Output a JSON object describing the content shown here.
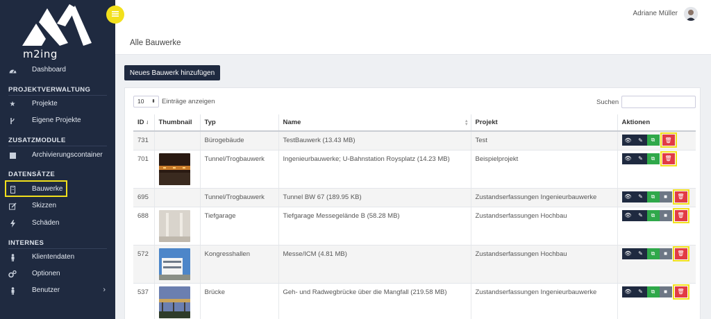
{
  "app": {
    "logo_text": "m2ing"
  },
  "user": {
    "name": "Adriane Müller"
  },
  "page": {
    "title": "Alle Bauwerke",
    "add_button": "Neues Bauwerk hinzufügen"
  },
  "sidebar": {
    "dashboard": "Dashboard",
    "sections": {
      "projekte": "PROJEKTVERWALTUNG",
      "zusatz": "ZUSATZMODULE",
      "daten": "DATENSÄTZE",
      "internes": "INTERNES"
    },
    "items": {
      "projekte": "Projekte",
      "eigene": "Eigene Projekte",
      "archiv": "Archivierungscontainer",
      "bauwerke": "Bauwerke",
      "skizzen": "Skizzen",
      "schaeden": "Schäden",
      "klientendaten": "Klientendaten",
      "optionen": "Optionen",
      "benutzer": "Benutzer"
    }
  },
  "table_controls": {
    "length_value": "10",
    "length_label": "Einträge anzeigen",
    "search_label": "Suchen"
  },
  "columns": [
    "ID",
    "Thumbnail",
    "Typ",
    "Name",
    "Projekt",
    "Aktionen"
  ],
  "rows": [
    {
      "id": "731",
      "typ": "Bürogebäude",
      "name": "TestBauwerk (13.43 MB)",
      "projekt": "Test"
    },
    {
      "id": "701",
      "typ": "Tunnel/Trogbauwerk",
      "name": "Ingenieurbauwerke; U-Bahnstation Roysplatz (14.23 MB)",
      "projekt": "Beispielprojekt"
    },
    {
      "id": "695",
      "typ": "Tunnel/Trogbauwerk",
      "name": "Tunnel BW 67 (189.95 KB)",
      "projekt": "Zustandserfassungen Ingenieurbauwerke"
    },
    {
      "id": "688",
      "typ": "Tiefgarage",
      "name": "Tiefgarage Messegelände B (58.28 MB)",
      "projekt": "Zustandserfassungen Hochbau"
    },
    {
      "id": "572",
      "typ": "Kongresshallen",
      "name": "Messe/ICM (4.81 MB)",
      "projekt": "Zustandserfassungen Hochbau"
    },
    {
      "id": "537",
      "typ": "Brücke",
      "name": "Geh- und Radwegbrücke über die Mangfall (219.58 MB)",
      "projekt": "Zustandserfassungen Ingenieurbauwerke"
    }
  ],
  "colors": {
    "sidebar": "#1f2a40",
    "highlight": "#f2e01c",
    "green": "#2fa84a",
    "red": "#e23b44"
  }
}
